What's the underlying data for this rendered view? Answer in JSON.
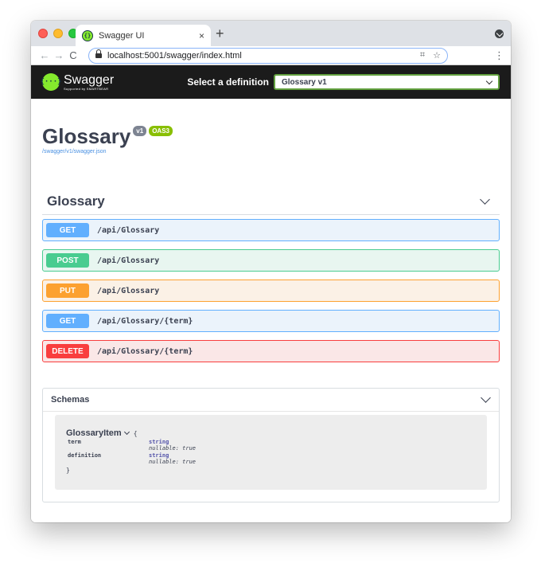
{
  "browser": {
    "tab_title": "Swagger UI",
    "tab_close": "×",
    "new_tab": "+",
    "url": "localhost:5001/swagger/index.html",
    "back": "←",
    "forward": "→",
    "reload": "C",
    "qr_icon": "⌗",
    "star_icon": "☆",
    "menu": "⋮"
  },
  "topbar": {
    "logo_glyph": "{···}",
    "logo_title": "Swagger",
    "logo_sub": "Supported by SMARTBEAR",
    "definition_label": "Select a definition",
    "definition_value": "Glossary v1"
  },
  "info": {
    "title": "Glossary",
    "version_badge": "v1",
    "oas_badge": "OAS3",
    "spec_link": "/swagger/v1/swagger.json"
  },
  "tag": {
    "title": "Glossary",
    "operations": [
      {
        "method": "GET",
        "path": "/api/Glossary",
        "kind": "get"
      },
      {
        "method": "POST",
        "path": "/api/Glossary",
        "kind": "post"
      },
      {
        "method": "PUT",
        "path": "/api/Glossary",
        "kind": "put"
      },
      {
        "method": "GET",
        "path": "/api/Glossary/{term}",
        "kind": "get"
      },
      {
        "method": "DELETE",
        "path": "/api/Glossary/{term}",
        "kind": "delete"
      }
    ]
  },
  "schemas": {
    "title": "Schemas",
    "model": {
      "name": "GlossaryItem",
      "open_brace": "{",
      "close_brace": "}",
      "properties": [
        {
          "name": "term",
          "type": "string",
          "extra": "nullable: true"
        },
        {
          "name": "definition",
          "type": "string",
          "extra": "nullable: true"
        }
      ]
    }
  },
  "colors": {
    "get": "#61affe",
    "post": "#49cc90",
    "put": "#fca130",
    "delete": "#f93e3e",
    "topbar": "#1b1b1b",
    "accent": "#85ea2d"
  }
}
